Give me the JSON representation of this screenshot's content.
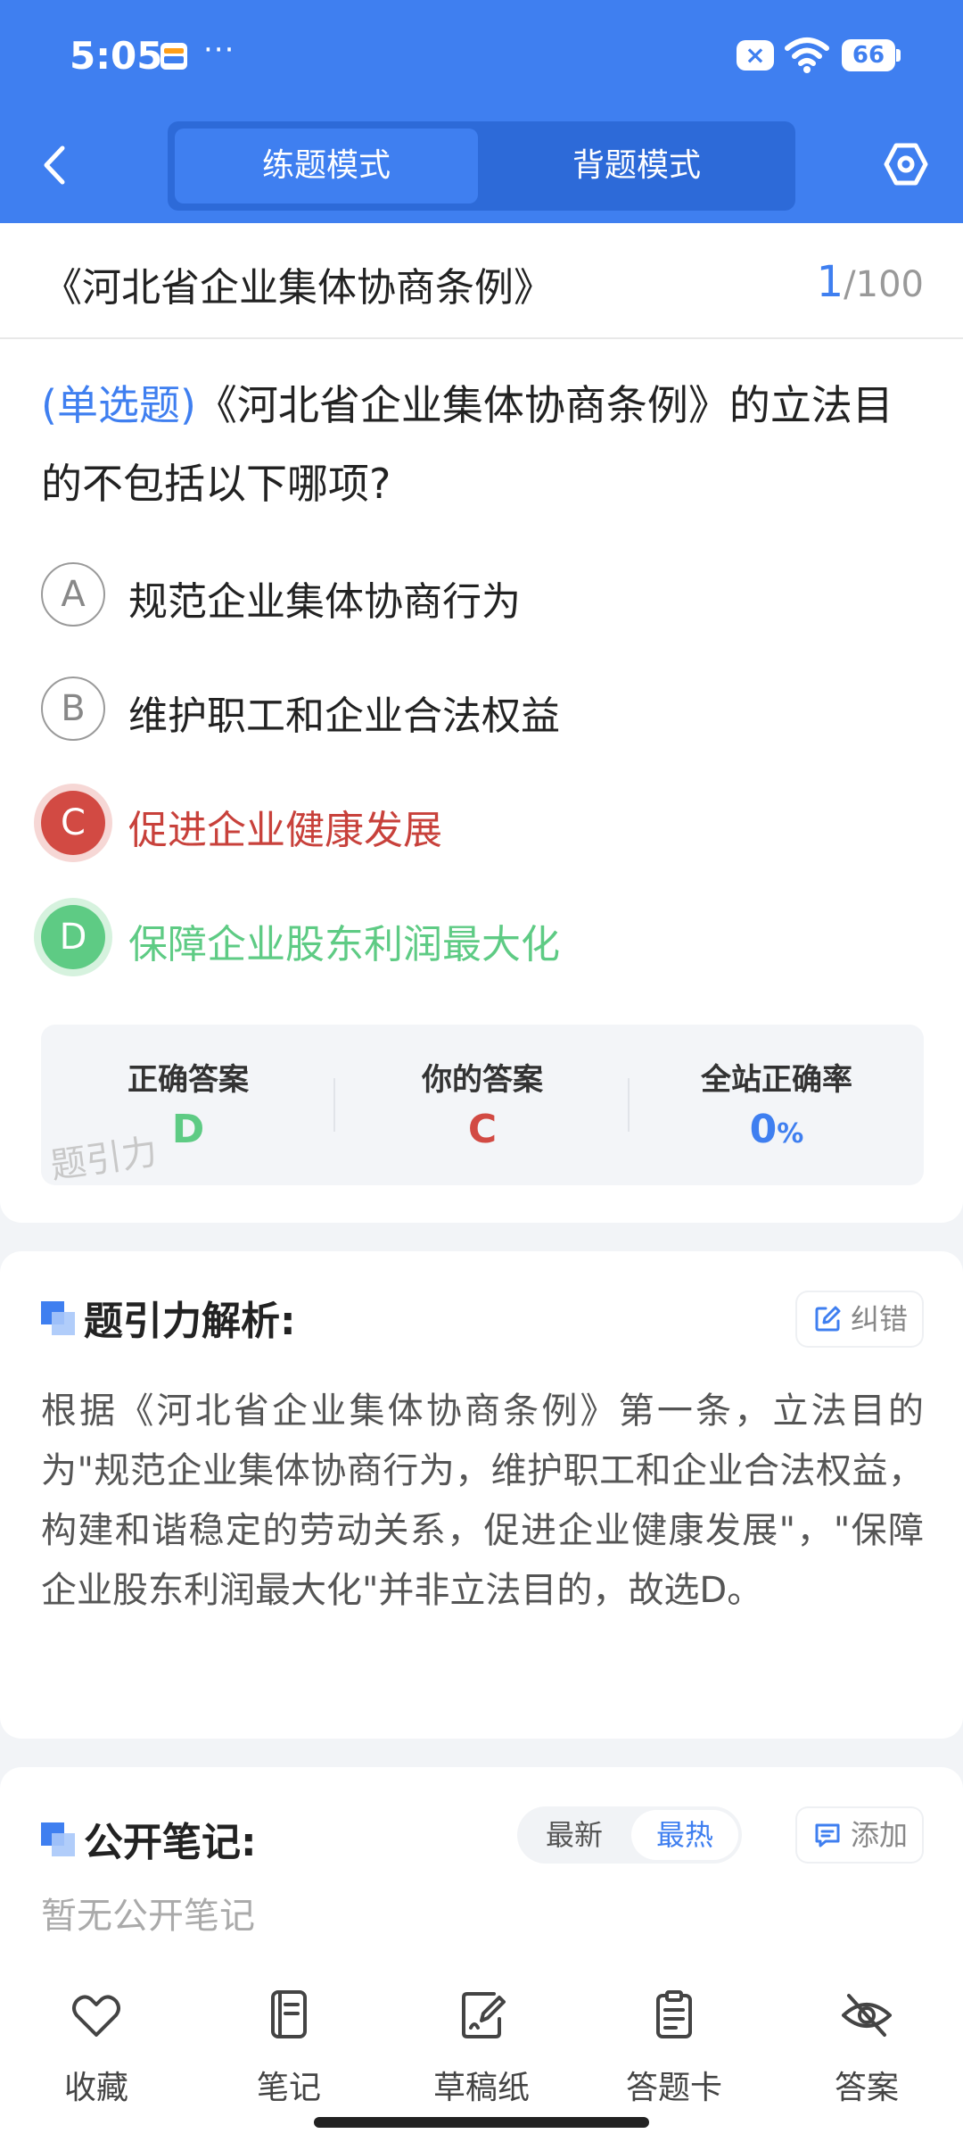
{
  "status_bar": {
    "time": "5:05",
    "dots": "···",
    "battery": "66"
  },
  "header": {
    "tabs": [
      "练题模式",
      "背题模式"
    ],
    "active_tab": "练题模式"
  },
  "question_card": {
    "book_title": "《河北省企业集体协商条例》",
    "page_current": "1",
    "page_total": "/100",
    "question_type": "(单选题)",
    "question_text": "《河北省企业集体协商条例》的立法目的不包括以下哪项?",
    "options": [
      {
        "letter": "A",
        "text": "规范企业集体协商行为",
        "state": "normal"
      },
      {
        "letter": "B",
        "text": "维护职工和企业合法权益",
        "state": "normal"
      },
      {
        "letter": "C",
        "text": "促进企业健康发展",
        "state": "wrong"
      },
      {
        "letter": "D",
        "text": "保障企业股东利润最大化",
        "state": "correct"
      }
    ],
    "answer_summary": {
      "correct_label": "正确答案",
      "correct_value": "D",
      "yours_label": "你的答案",
      "yours_value": "C",
      "rate_label": "全站正确率",
      "rate_value": "0",
      "rate_unit": "%",
      "watermark": "题引力"
    }
  },
  "analysis": {
    "title": "题引力解析:",
    "report_button": "纠错",
    "text": "根据《河北省企业集体协商条例》第一条，立法目的为\"规范企业集体协商行为，维护职工和企业合法权益，构建和谐稳定的劳动关系，促进企业健康发展\"，\"保障企业股东利润最大化\"并非立法目的，故选D。"
  },
  "notes": {
    "title": "公开笔记:",
    "sort_options": [
      "最新",
      "最热"
    ],
    "active_sort": "最热",
    "add_button": "添加",
    "empty_text": "暂无公开笔记"
  },
  "bottom_nav": {
    "items": [
      {
        "label": "收藏",
        "icon": "heart-icon"
      },
      {
        "label": "笔记",
        "icon": "notebook-icon"
      },
      {
        "label": "草稿纸",
        "icon": "draft-paper-icon"
      },
      {
        "label": "答题卡",
        "icon": "answer-sheet-icon"
      },
      {
        "label": "答案",
        "icon": "eye-off-icon"
      }
    ]
  },
  "colors": {
    "primary": "#3f7ff0",
    "wrong": "#d24a43",
    "correct": "#5ecb84"
  }
}
